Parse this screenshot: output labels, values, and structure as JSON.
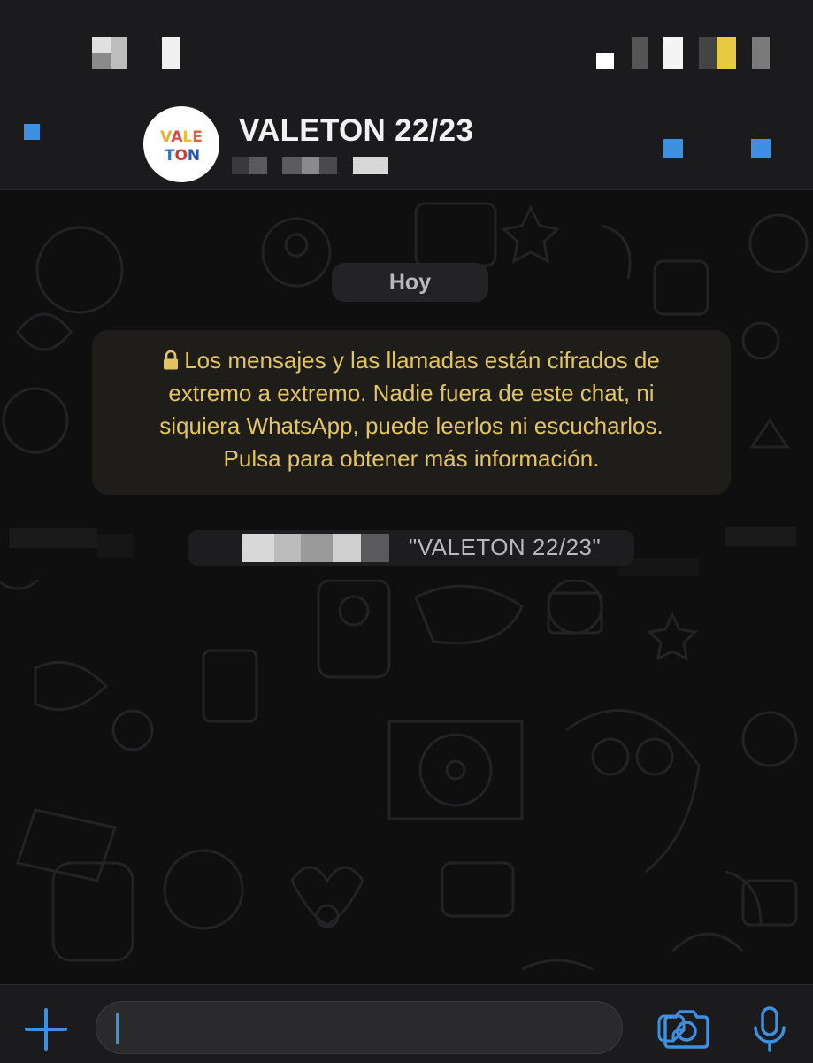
{
  "chat": {
    "title": "VALETON 22/23",
    "avatar_text_top": "VALE",
    "avatar_text_bottom": "TON"
  },
  "date_separator": "Hoy",
  "encryption_notice": {
    "line1": "Los mensajes y las llamadas están cifrados de",
    "line2": "extremo a extremo. Nadie fuera de este chat, ni",
    "line3": "siquiera WhatsApp, puede leerlos ni escucharlos.",
    "line4": "Pulsa para obtener más información."
  },
  "system_message": {
    "group_name_text": "\"VALETON 22/23\""
  },
  "composer": {
    "value": "",
    "placeholder": ""
  },
  "icons": {
    "back": "back-icon",
    "video_call": "video-call-icon",
    "voice_call": "phone-icon",
    "attach": "plus-icon",
    "sticker": "sticker-icon",
    "camera": "camera-icon",
    "mic": "microphone-icon",
    "lock": "lock-icon"
  },
  "colors": {
    "accent": "#3d8fe0",
    "notice_text": "#e2c55f",
    "background": "#0f0f10"
  }
}
